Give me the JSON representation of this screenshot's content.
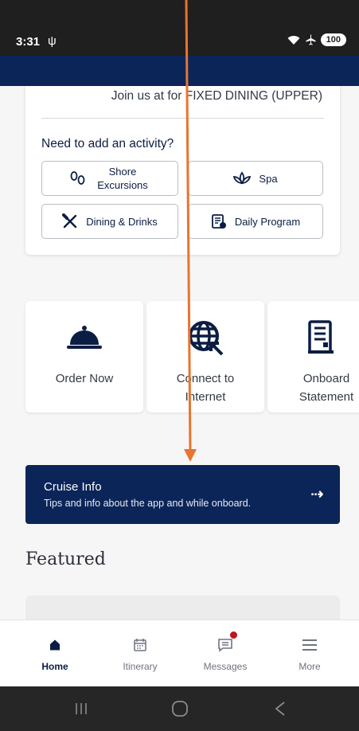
{
  "status_bar": {
    "time": "3:31",
    "usb_icon": "usb-icon",
    "network": "ᴳ",
    "battery": "100"
  },
  "activity_card": {
    "dining_text": "Join us at for FIXED DINING (UPPER)",
    "need_title": "Need to add an activity?",
    "buttons": [
      {
        "label": "Shore Excursions",
        "icon": "footprints-icon"
      },
      {
        "label": "Spa",
        "icon": "lotus-icon"
      },
      {
        "label": "Dining & Drinks",
        "icon": "utensils-icon"
      },
      {
        "label": "Daily Program",
        "icon": "program-icon"
      }
    ]
  },
  "quick_actions": [
    {
      "label": "Order Now",
      "icon": "cloche-icon"
    },
    {
      "label": "Connect to Internet",
      "icon": "globe-icon"
    },
    {
      "label": "Onboard Statement",
      "icon": "receipt-icon"
    }
  ],
  "cruise_info": {
    "title": "Cruise Info",
    "subtitle": "Tips and info about the app and while onboard."
  },
  "featured": {
    "title": "Featured"
  },
  "bottom_nav": [
    {
      "label": "Home",
      "icon": "home-icon",
      "active": true
    },
    {
      "label": "Itinerary",
      "icon": "calendar-icon"
    },
    {
      "label": "Messages",
      "icon": "messages-icon",
      "badge": true
    },
    {
      "label": "More",
      "icon": "menu-icon"
    }
  ],
  "colors": {
    "navy": "#0b2558",
    "annotation": "#e8742e",
    "badge": "#c0141a"
  }
}
